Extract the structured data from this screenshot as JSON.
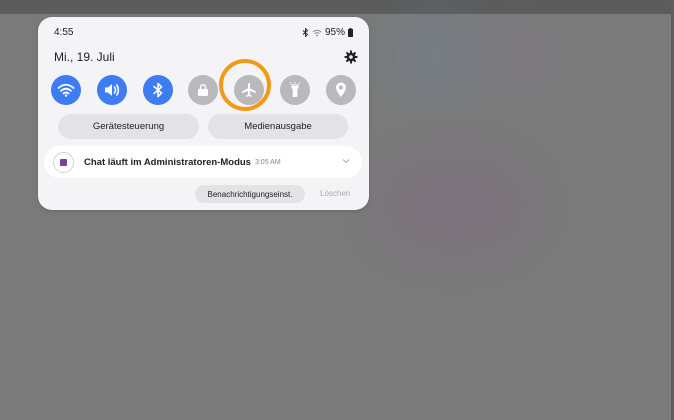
{
  "status": {
    "time": "4:55",
    "battery": "95%"
  },
  "date": "Mi., 19. Juli",
  "toggles": [
    {
      "name": "wifi",
      "state": "on"
    },
    {
      "name": "sound",
      "state": "on"
    },
    {
      "name": "bluetooth",
      "state": "on"
    },
    {
      "name": "rotation-lock",
      "state": "off"
    },
    {
      "name": "airplane-mode",
      "state": "off"
    },
    {
      "name": "flashlight",
      "state": "off"
    },
    {
      "name": "location",
      "state": "off"
    }
  ],
  "buttons": {
    "device_control": "Gerätesteuerung",
    "media_output": "Medienausgabe"
  },
  "notification": {
    "text": "Chat läuft im Administratoren-Modus",
    "time": "3:05 AM"
  },
  "actions": {
    "settings": "Benachrichtigungseinst.",
    "clear": "Löschen"
  },
  "colors": {
    "accent_on": "#3e7cf2",
    "toggle_off": "#b8b8bd",
    "highlight": "#f29a16",
    "panel_bg": "#f4f4f6"
  }
}
